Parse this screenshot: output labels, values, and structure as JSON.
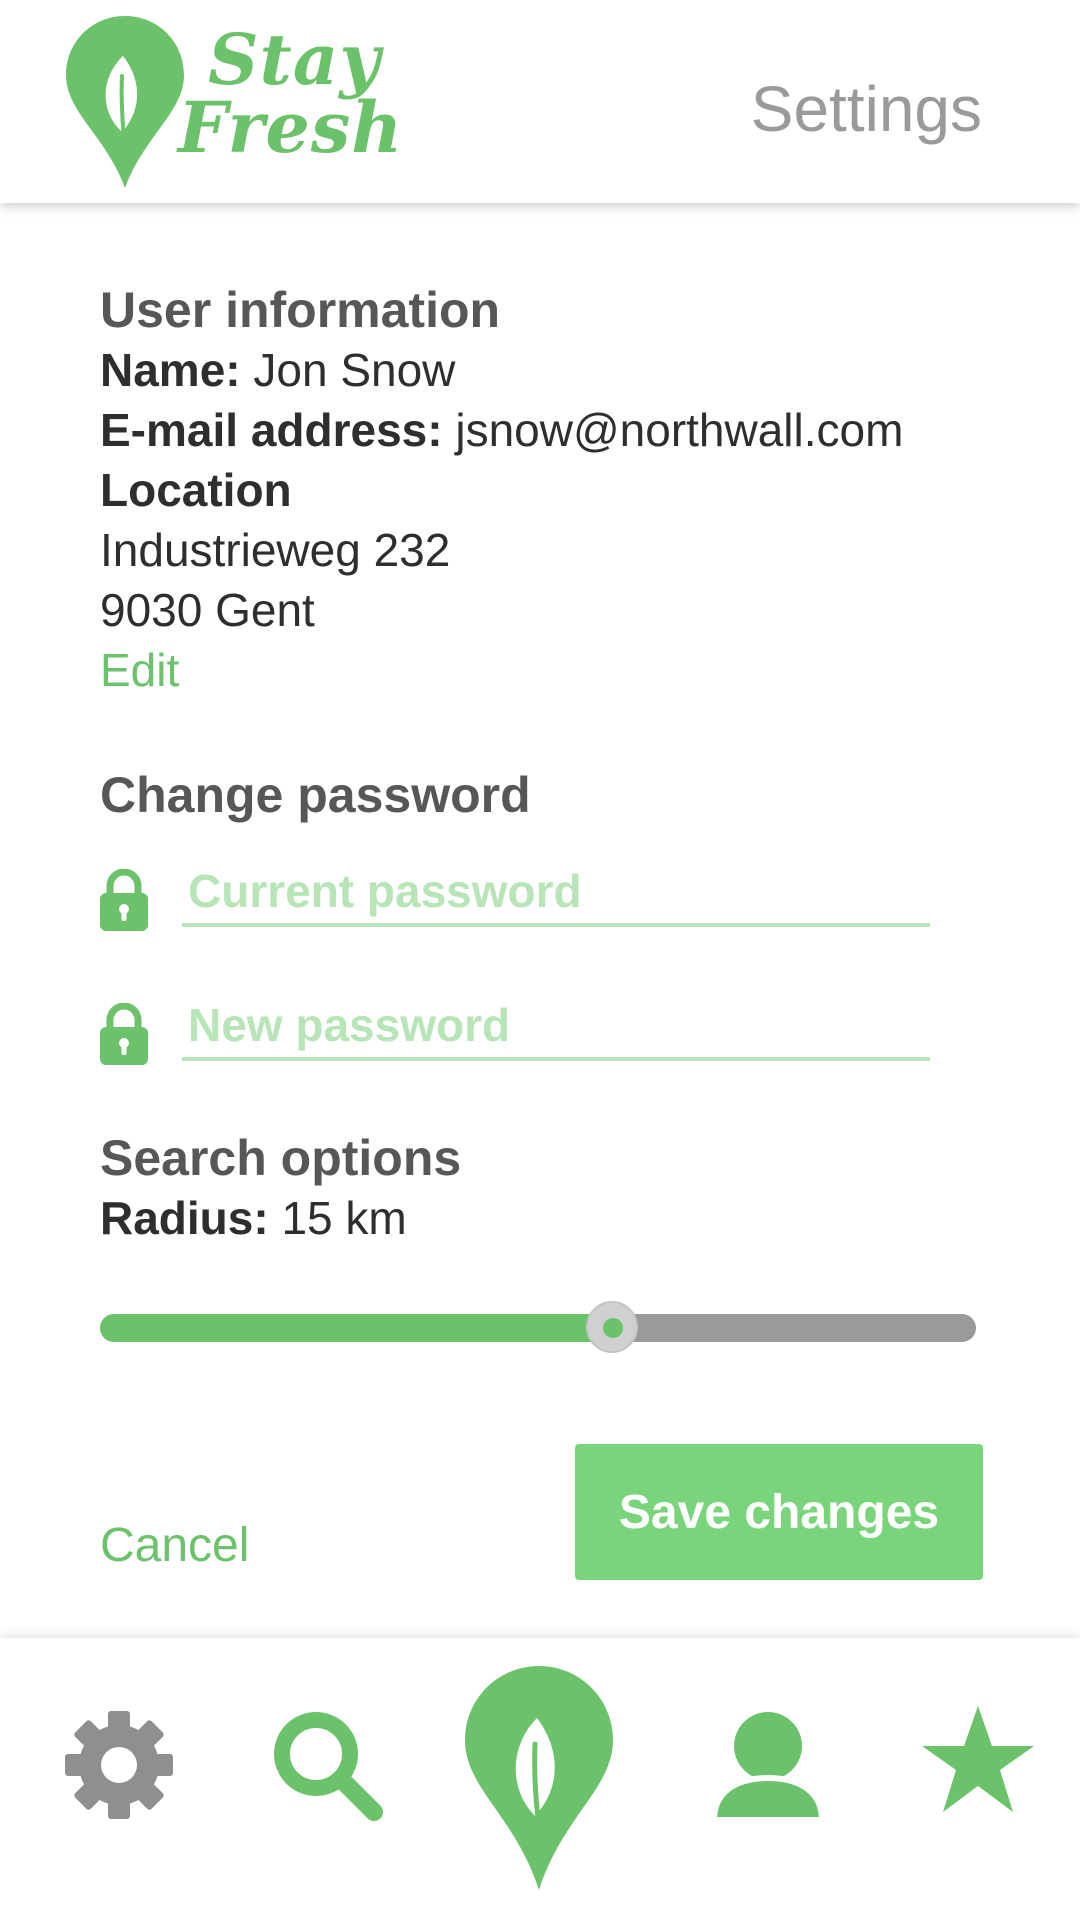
{
  "header": {
    "logo": {
      "line1": "Stay",
      "line2": "Fresh"
    },
    "title": "Settings"
  },
  "user_info": {
    "heading": "User information",
    "name_label": "Name:",
    "name_value": "Jon Snow",
    "email_label": "E-mail address:",
    "email_value": "jsnow@northwall.com",
    "location_label": "Location",
    "address_line1": "Industrieweg 232",
    "address_line2": "9030 Gent",
    "edit_label": "Edit"
  },
  "password": {
    "heading": "Change password",
    "current_placeholder": "Current password",
    "new_placeholder": "New password"
  },
  "search": {
    "heading": "Search options",
    "radius_label": "Radius:",
    "radius_value": "15 km",
    "slider_fraction": 0.585
  },
  "actions": {
    "cancel_label": "Cancel",
    "save_label": "Save changes"
  },
  "bottom_nav": {
    "items": [
      {
        "icon": "gear-icon",
        "active": true
      },
      {
        "icon": "search-icon",
        "active": false
      },
      {
        "icon": "leaf-pin-icon",
        "active": false
      },
      {
        "icon": "user-icon",
        "active": false
      },
      {
        "icon": "star-icon",
        "active": false
      }
    ]
  },
  "colors": {
    "brand_green": "#6cc26b",
    "light_green": "#b8e5b7",
    "button_green": "#7ad47c",
    "active_icon_gray": "#8f8f8f",
    "title_gray": "#9a9a9a"
  }
}
